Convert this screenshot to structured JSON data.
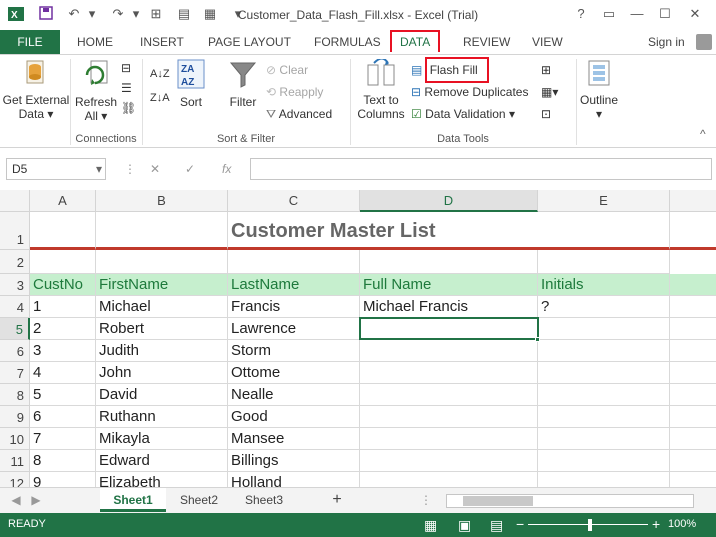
{
  "app": {
    "title": "Customer_Data_Flash_Fill.xlsx - Excel (Trial)",
    "help": "?",
    "sign_in": "Sign in"
  },
  "tabs": [
    "FILE",
    "HOME",
    "INSERT",
    "PAGE LAYOUT",
    "FORMULAS",
    "DATA",
    "REVIEW",
    "VIEW"
  ],
  "ribbon": {
    "get_external_data": [
      "Get External",
      "Data ▾"
    ],
    "refresh_all": [
      "Refresh",
      "All ▾"
    ],
    "connections_group": "Connections",
    "sort": "Sort",
    "filter": "Filter",
    "clear": "Clear",
    "reapply": "Reapply",
    "advanced": "Advanced",
    "sort_filter_group": "Sort & Filter",
    "text_to_columns": [
      "Text to",
      "Columns"
    ],
    "flash_fill": "Flash Fill",
    "remove_duplicates": "Remove Duplicates",
    "data_validation": "Data Validation ▾",
    "data_tools_group": "Data Tools",
    "outline": "Outline"
  },
  "formula_bar": {
    "name_box": "D5",
    "fx": "fx",
    "formula": ""
  },
  "columns": [
    "A",
    "B",
    "C",
    "D",
    "E"
  ],
  "rows": [
    {
      "num": "1",
      "cells": [
        "",
        "",
        "Customer Master List",
        "",
        ""
      ]
    },
    {
      "num": "2",
      "cells": [
        "",
        "",
        "",
        "",
        ""
      ]
    },
    {
      "num": "3",
      "cells": [
        "CustNo",
        "FirstName",
        "LastName",
        "Full Name",
        "Initials"
      ]
    },
    {
      "num": "4",
      "cells": [
        "1",
        "Michael",
        "Francis",
        "Michael Francis",
        "?"
      ]
    },
    {
      "num": "5",
      "cells": [
        "2",
        "Robert",
        "Lawrence",
        "",
        ""
      ]
    },
    {
      "num": "6",
      "cells": [
        "3",
        "Judith",
        "Storm",
        "",
        ""
      ]
    },
    {
      "num": "7",
      "cells": [
        "4",
        "John",
        "Ottome",
        "",
        ""
      ]
    },
    {
      "num": "8",
      "cells": [
        "5",
        "David",
        "Nealle",
        "",
        ""
      ]
    },
    {
      "num": "9",
      "cells": [
        "6",
        "Ruthann",
        "Good",
        "",
        ""
      ]
    },
    {
      "num": "10",
      "cells": [
        "7",
        "Mikayla",
        "Mansee",
        "",
        ""
      ]
    },
    {
      "num": "11",
      "cells": [
        "8",
        "Edward",
        "Billings",
        "",
        ""
      ]
    },
    {
      "num": "12",
      "cells": [
        "9",
        "Elizabeth",
        "Holland",
        "",
        ""
      ]
    }
  ],
  "sheets": [
    "Sheet1",
    "Sheet2",
    "Sheet3"
  ],
  "add_sheet": "+",
  "status": {
    "ready": "READY",
    "zoom": "100%"
  },
  "colors": {
    "excel_green": "#217346",
    "header_fill": "#c6efce",
    "highlight_red": "#e81123",
    "title_rule": "#c0392b"
  }
}
